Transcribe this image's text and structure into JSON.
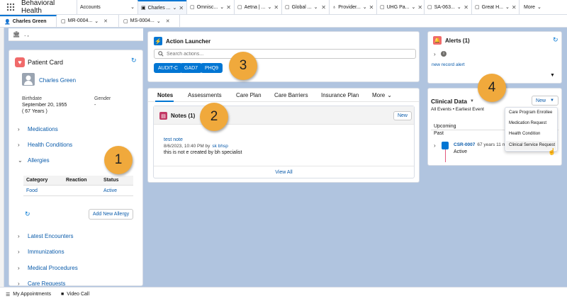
{
  "app": {
    "name": "Behavioral Health"
  },
  "nav": {
    "accounts": "Accounts",
    "tabs": [
      {
        "label": "Charles ..."
      },
      {
        "label": "Omnisc..."
      },
      {
        "label": "Aetna | ..."
      },
      {
        "label": "Global ..."
      },
      {
        "label": "Provider..."
      },
      {
        "label": "UHG Pa..."
      },
      {
        "label": "SA-063..."
      },
      {
        "label": "Great H..."
      }
    ],
    "more": "More"
  },
  "subtabs": [
    {
      "label": "Charles Green"
    },
    {
      "label": "MR-0004..."
    },
    {
      "label": "MS-0004..."
    }
  ],
  "recstrip": {
    "text": ". ,"
  },
  "patient": {
    "title": "Patient Card",
    "name": "Charles Green",
    "birthdate_label": "Birthdate",
    "birthdate": "September 20, 1955",
    "age": "( 67 Years )",
    "gender_label": "Gender",
    "gender": "-",
    "sections_top": [
      "Medications",
      "Health Conditions",
      "Allergies"
    ],
    "allergy_headers": [
      "Category",
      "Reaction",
      "Status"
    ],
    "allergy_row": [
      "Food",
      "",
      "Active"
    ],
    "add_allergy": "Add New Allergy",
    "sections_bottom": [
      "Latest Encounters",
      "Immunizations",
      "Medical Procedures",
      "Care Requests"
    ]
  },
  "launcher": {
    "title": "Action Launcher",
    "search_placeholder": "Search actions...",
    "actions": [
      "AUDIT-C",
      "GAD7",
      "PHQ9"
    ]
  },
  "tabs": {
    "items": [
      "Notes",
      "Assessments",
      "Care Plan",
      "Care Barriers",
      "Insurance Plan"
    ],
    "more": "More"
  },
  "notes": {
    "title": "Notes (1)",
    "new_label": "New",
    "note_title": "test note",
    "note_meta": "8/6/2023, 10:40 PM by",
    "note_author": "sk bhsp",
    "note_body": "this is not e created by bh specialist",
    "view_all": "View All"
  },
  "alerts": {
    "title": "Alerts (1)",
    "record_alert": "new record alert"
  },
  "clinical": {
    "title": "Clinical Data",
    "filter": "All Events • Earliest Event",
    "new_label": "New",
    "upcoming": "Upcoming",
    "past": "Past",
    "event_id": "CSR-0007",
    "event_meta": "67 years 11 mo",
    "event_status": "Active",
    "menu": [
      "Care Program Enrollee",
      "Medication Request",
      "Health Condition",
      "Clinical Service Request"
    ]
  },
  "badges": [
    "1",
    "2",
    "3",
    "4"
  ],
  "bottom": {
    "appointments": "My Appointments",
    "video": "Video Call"
  },
  "colors": {
    "brand": "#0176d3",
    "badge": "#f0a93c",
    "patient_icon": "#f06a6a",
    "notes_icon": "#c23965",
    "alerts_icon": "#f06a6a"
  }
}
